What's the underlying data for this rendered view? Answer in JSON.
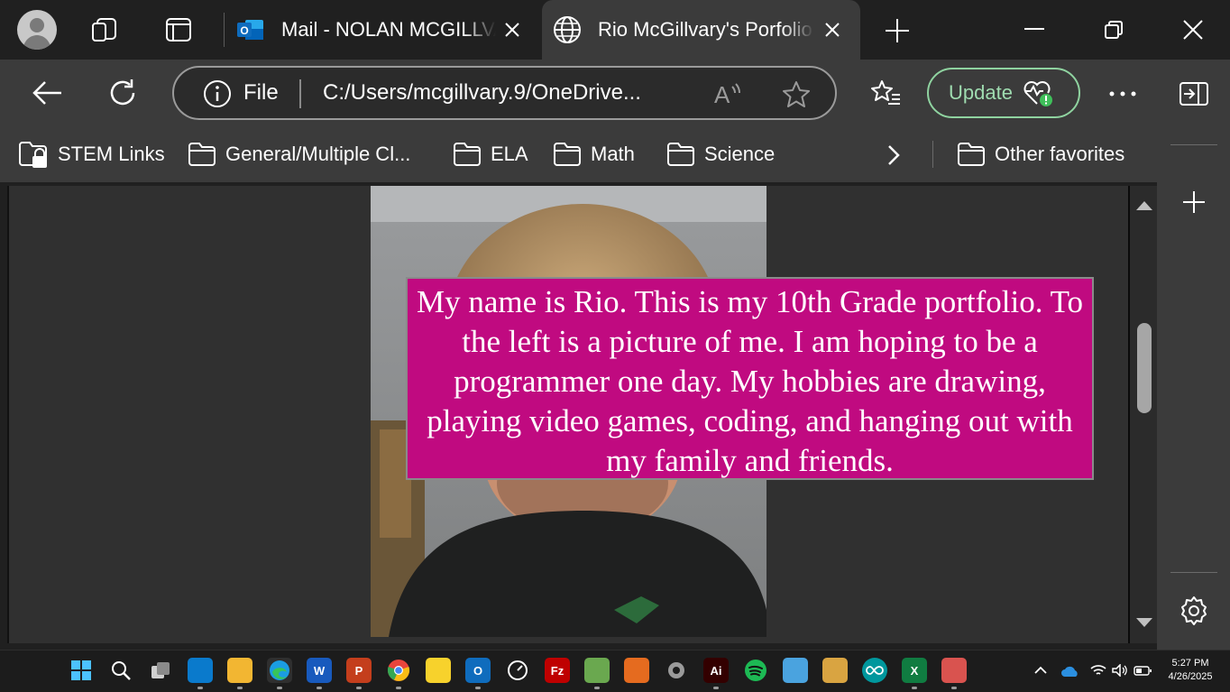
{
  "tabs": [
    {
      "title": "Mail - NOLAN MCGILLVARY - Outlook",
      "icon": "outlook-icon",
      "active": false
    },
    {
      "title": "Rio McGillvary's Porfolio",
      "icon": "globe-icon",
      "active": true
    }
  ],
  "address_bar": {
    "scheme_label": "File",
    "url": "C:/Users/mcgillvary.9/OneDrive..."
  },
  "update_button": {
    "label": "Update"
  },
  "favorites": [
    {
      "label": "STEM Links",
      "icon": "folder-lock-icon"
    },
    {
      "label": "General/Multiple Cl...",
      "icon": "folder-icon"
    },
    {
      "label": "ELA",
      "icon": "folder-icon"
    },
    {
      "label": "Math",
      "icon": "folder-icon"
    },
    {
      "label": "Science",
      "icon": "folder-icon"
    }
  ],
  "other_favorites": {
    "label": "Other favorites"
  },
  "page": {
    "bio_text": "My name is Rio. This is my 10th Grade portfolio. To the left is a picture of me. I am hoping to be a programmer one day. My hobbies are drawing, playing video games, coding, and hanging out with my family and friends."
  },
  "taskbar": {
    "apps": [
      {
        "name": "start",
        "color": "#1e90ff"
      },
      {
        "name": "search",
        "color": "#1c1c1c"
      },
      {
        "name": "task-view",
        "color": "#1c1c1c"
      },
      {
        "name": "vscode",
        "color": "#0a7acc"
      },
      {
        "name": "file-explorer",
        "color": "#f2b632"
      },
      {
        "name": "edge",
        "color": "#1b9de2"
      },
      {
        "name": "word",
        "color": "#185abd",
        "letter": "W"
      },
      {
        "name": "powerpoint",
        "color": "#c43e1c",
        "letter": "P"
      },
      {
        "name": "chrome",
        "color": "#e8453c"
      },
      {
        "name": "sticky-notes",
        "color": "#f7d22c"
      },
      {
        "name": "outlook",
        "color": "#0f6cbd",
        "letter": "O"
      },
      {
        "name": "speedometer",
        "color": "#2b2b2b"
      },
      {
        "name": "filezilla",
        "color": "#bf0000",
        "letter": "Fz"
      },
      {
        "name": "image-viewer",
        "color": "#6aa84f"
      },
      {
        "name": "game-app",
        "color": "#e56b1f"
      },
      {
        "name": "settings",
        "color": "#777777"
      },
      {
        "name": "illustrator",
        "color": "#330000",
        "letter": "Ai"
      },
      {
        "name": "spotify",
        "color": "#1db954"
      },
      {
        "name": "remote-app",
        "color": "#4aa3df"
      },
      {
        "name": "photo-app",
        "color": "#d9a441"
      },
      {
        "name": "arduino",
        "color": "#00979d"
      },
      {
        "name": "excel",
        "color": "#107c41",
        "letter": "X"
      },
      {
        "name": "snip-app",
        "color": "#d9534f"
      }
    ],
    "time": "5:27 PM",
    "date": "4/26/2025"
  }
}
